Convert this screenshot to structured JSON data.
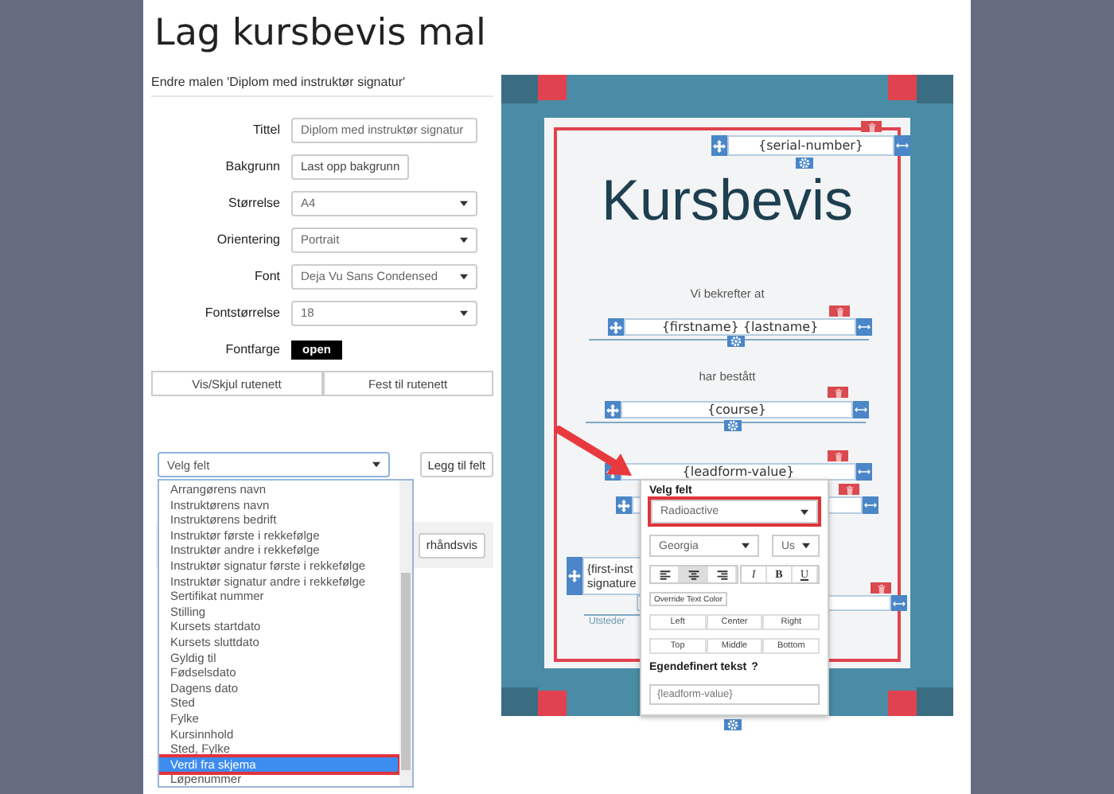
{
  "page_title": "Lag kursbevis mal",
  "form": {
    "heading": "Endre malen 'Diplom med instruktør signatur'",
    "fields": [
      {
        "label": "Tittel",
        "kind": "text",
        "value": "Diplom med instruktør signatur"
      },
      {
        "label": "Bakgrunn",
        "kind": "button",
        "value": "Last opp bakgrunn"
      },
      {
        "label": "Størrelse",
        "kind": "select",
        "value": "A4"
      },
      {
        "label": "Orientering",
        "kind": "select",
        "value": "Portrait"
      },
      {
        "label": "Font",
        "kind": "select",
        "value": "Deja Vu Sans Condensed"
      },
      {
        "label": "Fontstørrelse",
        "kind": "select",
        "value": "18"
      },
      {
        "label": "Fontfarge",
        "kind": "color",
        "value": "open"
      }
    ],
    "grid_buttons": [
      "Vis/Skjul rutenett",
      "Fest til rutenett"
    ]
  },
  "field_picker": {
    "value": "Velg felt",
    "add_button": "Legg til felt",
    "options": [
      {
        "label": "Arrangørens navn",
        "selected": false
      },
      {
        "label": "Instruktørens navn",
        "selected": false
      },
      {
        "label": "Instruktørens bedrift",
        "selected": false
      },
      {
        "label": "Instruktør første i rekkefølge",
        "selected": false
      },
      {
        "label": "Instruktør andre i rekkefølge",
        "selected": false
      },
      {
        "label": "Instruktør signatur første i rekkefølge",
        "selected": false
      },
      {
        "label": "Instruktør signatur andre i rekkefølge",
        "selected": false
      },
      {
        "label": "Sertifikat nummer",
        "selected": false
      },
      {
        "label": "Stilling",
        "selected": false
      },
      {
        "label": "Kursets startdato",
        "selected": false
      },
      {
        "label": "Kursets sluttdato",
        "selected": false
      },
      {
        "label": "Gyldig til",
        "selected": false
      },
      {
        "label": "Fødselsdato",
        "selected": false
      },
      {
        "label": "Dagens dato",
        "selected": false
      },
      {
        "label": "Sted",
        "selected": false
      },
      {
        "label": "Fylke",
        "selected": false
      },
      {
        "label": "Kursinnhold",
        "selected": false
      },
      {
        "label": "Sted, Fylke",
        "selected": false
      },
      {
        "label": "Verdi fra skjema",
        "selected": true
      },
      {
        "label": "Løpenummer",
        "selected": false
      }
    ]
  },
  "preview_button": "rhåndsvis",
  "certificate": {
    "title": "Kursbevis",
    "texts": [
      "Vi bekrefter at",
      "har bestått"
    ],
    "issuer_label": "Utsteder",
    "fields": [
      {
        "kind": "text",
        "lines": [
          "{serial-number}"
        ]
      },
      {
        "kind": "text",
        "lines": [
          "{firstname} {lastname}"
        ]
      },
      {
        "kind": "text",
        "lines": [
          "{course}"
        ]
      },
      {
        "kind": "text",
        "lines": [
          "{leadform-value}"
        ]
      },
      {
        "kind": "covered"
      },
      {
        "kind": "text",
        "lines": [
          "{first-inst",
          "signature"
        ]
      },
      {
        "kind": "covered"
      }
    ]
  },
  "popup": {
    "title": "Velg felt",
    "field_value": "Radioactive",
    "font": "Georgia",
    "size": "Us",
    "align": [
      {
        "selected": false
      },
      {
        "selected": true
      },
      {
        "selected": false
      }
    ],
    "styles": [
      "I",
      "B",
      "U"
    ],
    "override_button": "Override Text Color",
    "h_align": [
      "Left",
      "Center",
      "Right"
    ],
    "v_align": [
      "Top",
      "Middle",
      "Bottom"
    ],
    "custom_label": "Egendefinert tekst",
    "help": "?",
    "custom_value": "{leadform-value}"
  }
}
